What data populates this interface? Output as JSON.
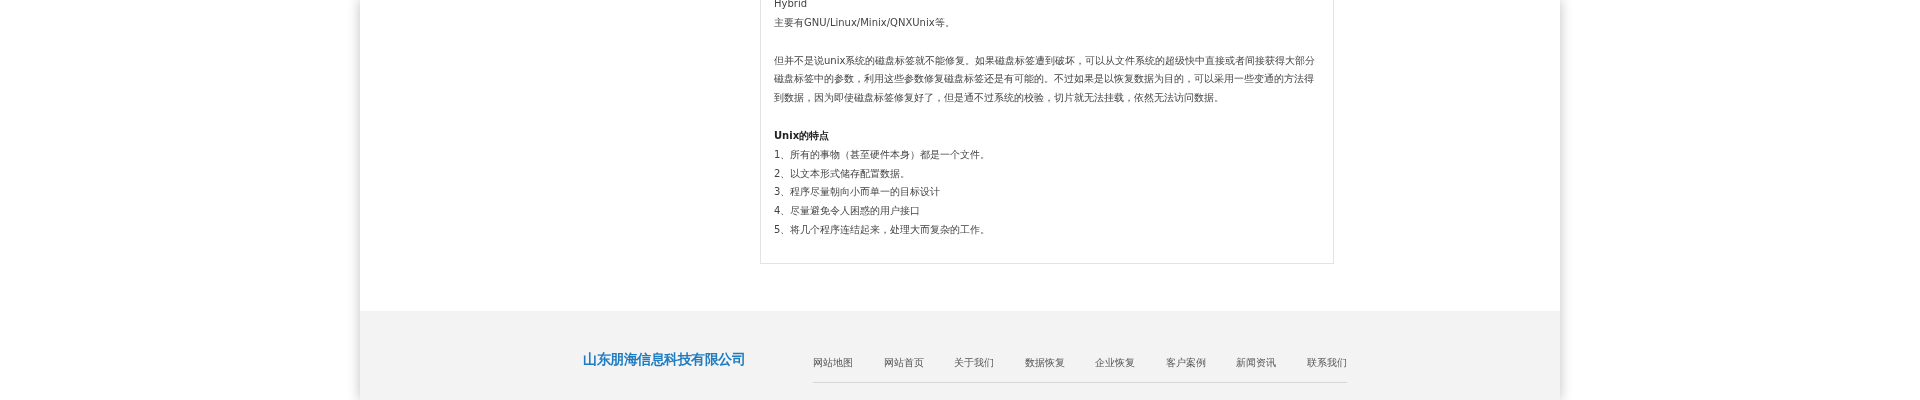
{
  "article": {
    "lines": [
      "Hybrid",
      "主要有GNU/Linux/Minix/QNXUnix等。"
    ],
    "paragraph": "但并不是说unix系统的磁盘标签就不能修复。如果磁盘标签遭到破坏，可以从文件系统的超级快中直接或者间接获得大部分磁盘标签中的参数，利用这些参数修复磁盘标签还是有可能的。不过如果是以恢复数据为目的，可以采用一些变通的方法得到数据，因为即使磁盘标签修复好了，但是通不过系统的校验，切片就无法挂载，依然无法访问数据。",
    "heading": "Unix的特点",
    "list": [
      "1、所有的事物（甚至硬件本身）都是一个文件。",
      "2、以文本形式储存配置数据。",
      "3、程序尽量朝向小而单一的目标设计",
      "4、尽量避免令人困惑的用户接口",
      "5、将几个程序连结起来，处理大而复杂的工作。"
    ]
  },
  "footer": {
    "company": "山东朋海信息科技有限公司",
    "nav": [
      "网站地图",
      "网站首页",
      "关于我们",
      "数据恢复",
      "企业恢复",
      "客户案例",
      "新闻资讯",
      "联系我们"
    ]
  }
}
